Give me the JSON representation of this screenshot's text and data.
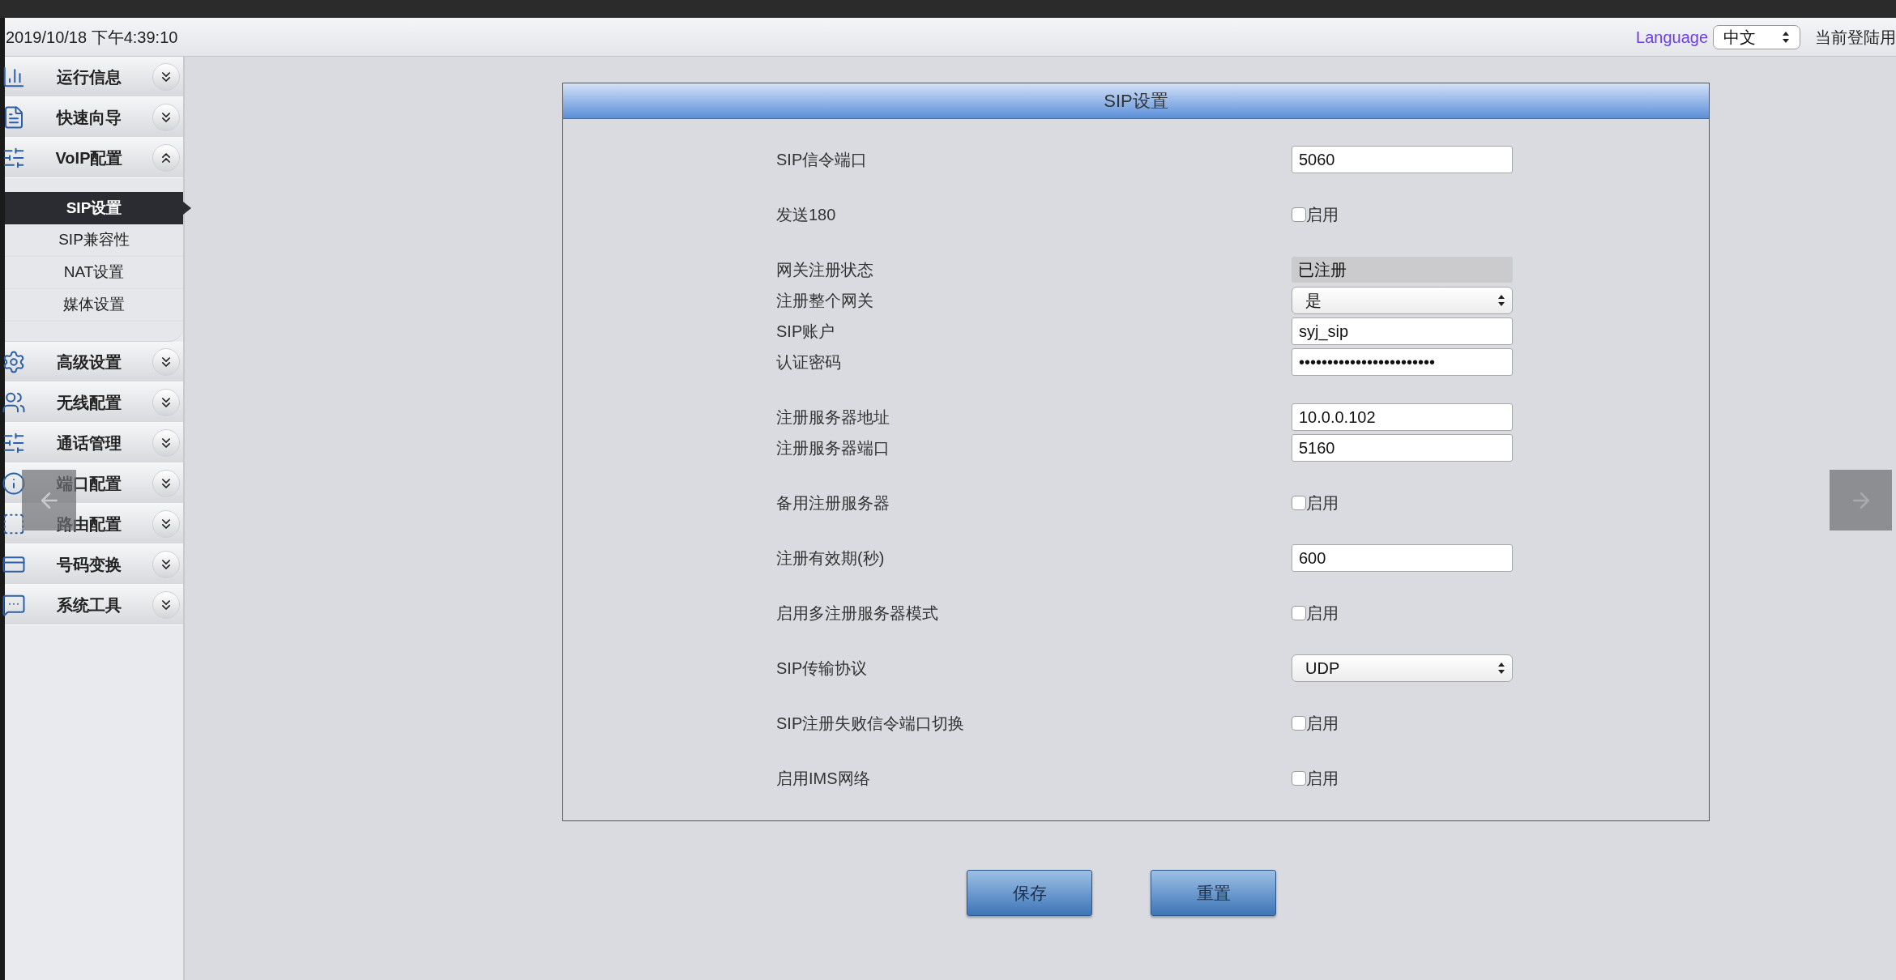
{
  "header": {
    "datetime": "2019/10/18 下午4:39:10",
    "language_label": "Language",
    "language_value": "中文",
    "user_label": "当前登陆用"
  },
  "sidebar": {
    "items": [
      {
        "label": "运行信息",
        "expanded": false
      },
      {
        "label": "快速向导",
        "expanded": false
      },
      {
        "label": "VoIP配置",
        "expanded": true,
        "children": [
          {
            "label": "SIP设置",
            "selected": true
          },
          {
            "label": "SIP兼容性",
            "selected": false
          },
          {
            "label": "NAT设置",
            "selected": false
          },
          {
            "label": "媒体设置",
            "selected": false
          }
        ]
      },
      {
        "label": "高级设置",
        "expanded": false
      },
      {
        "label": "无线配置",
        "expanded": false
      },
      {
        "label": "通话管理",
        "expanded": false
      },
      {
        "label": "端口配置",
        "expanded": false
      },
      {
        "label": "路由配置",
        "expanded": false
      },
      {
        "label": "号码变换",
        "expanded": false
      },
      {
        "label": "系统工具",
        "expanded": false
      }
    ]
  },
  "panel": {
    "title": "SIP设置",
    "groups": [
      [
        {
          "label": "SIP信令端口",
          "kind": "input",
          "value": "5060"
        }
      ],
      [
        {
          "label": "发送180",
          "kind": "checkbox",
          "checked": false,
          "text": "启用"
        }
      ],
      [
        {
          "label": "网关注册状态",
          "kind": "status",
          "value": "已注册"
        },
        {
          "label": "注册整个网关",
          "kind": "select",
          "value": "是"
        },
        {
          "label": "SIP账户",
          "kind": "input",
          "value": "syj_sip"
        },
        {
          "label": "认证密码",
          "kind": "input",
          "value": "••••••••••••••••••••••••"
        }
      ],
      [
        {
          "label": "注册服务器地址",
          "kind": "input",
          "value": "10.0.0.102"
        },
        {
          "label": "注册服务器端口",
          "kind": "input",
          "value": "5160"
        }
      ],
      [
        {
          "label": "备用注册服务器",
          "kind": "checkbox",
          "checked": false,
          "text": "启用"
        }
      ],
      [
        {
          "label": "注册有效期(秒)",
          "kind": "input",
          "value": "600"
        }
      ],
      [
        {
          "label": "启用多注册服务器模式",
          "kind": "checkbox",
          "checked": false,
          "text": "启用"
        }
      ],
      [
        {
          "label": "SIP传输协议",
          "kind": "select",
          "value": "UDP"
        }
      ],
      [
        {
          "label": "SIP注册失败信令端口切换",
          "kind": "checkbox",
          "checked": false,
          "text": "启用"
        }
      ],
      [
        {
          "label": "启用IMS网络",
          "kind": "checkbox",
          "checked": false,
          "text": "启用"
        }
      ]
    ]
  },
  "buttons": [
    {
      "label": "保存"
    },
    {
      "label": "重置"
    }
  ]
}
